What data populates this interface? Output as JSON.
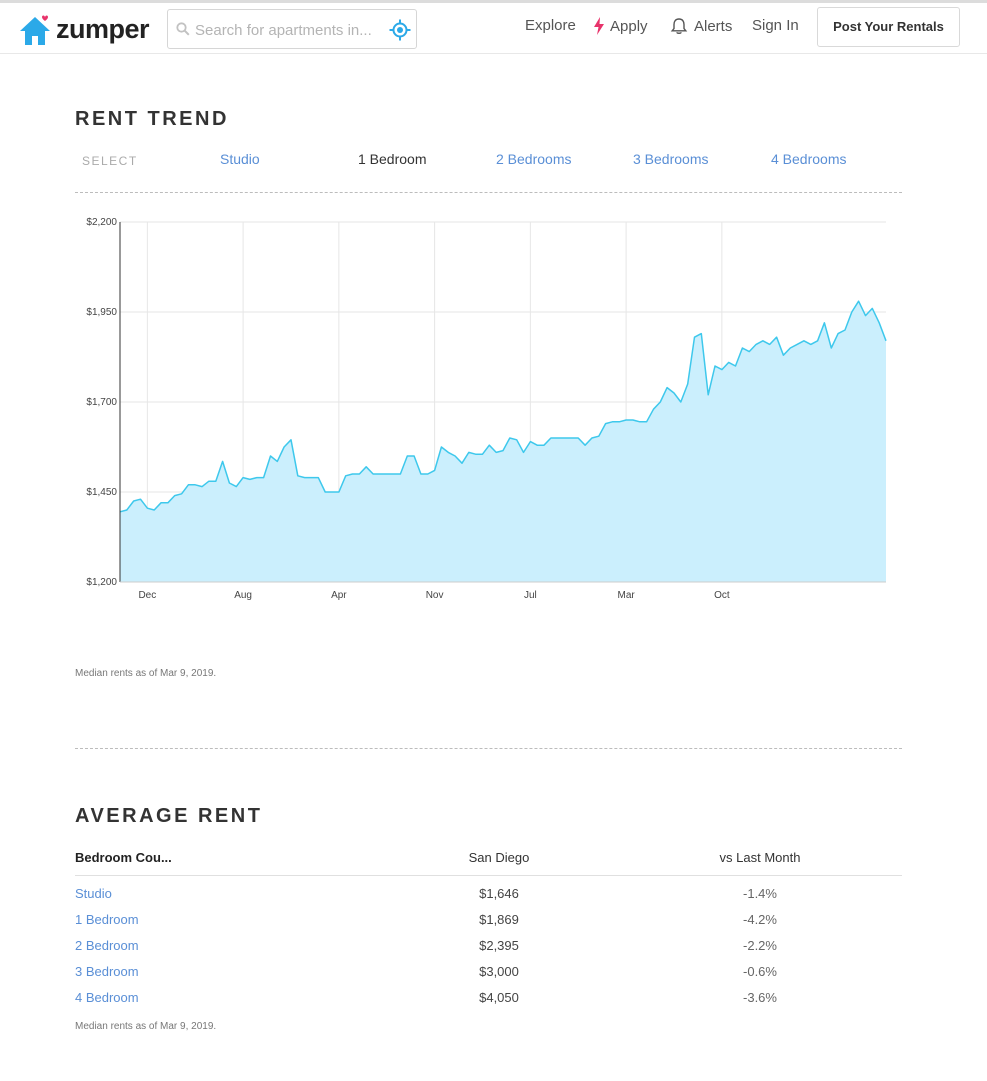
{
  "header": {
    "brand": "zumper",
    "search_placeholder": "Search for apartments in...",
    "nav": {
      "explore": "Explore",
      "apply": "Apply",
      "alerts": "Alerts",
      "sign_in": "Sign In"
    },
    "post_button": "Post Your Rentals",
    "colors": {
      "brand_blue": "#2ba9e8",
      "heart": "#e8336b",
      "apply_bolt": "#e8336b"
    }
  },
  "rent_trend": {
    "title": "RENT TREND",
    "select_label": "SELECT",
    "tabs": [
      {
        "label": "Studio",
        "active": false
      },
      {
        "label": "1 Bedroom",
        "active": true
      },
      {
        "label": "2 Bedrooms",
        "active": false
      },
      {
        "label": "3 Bedrooms",
        "active": false
      },
      {
        "label": "4 Bedrooms",
        "active": false
      }
    ],
    "note": "Median rents as of Mar 9, 2019."
  },
  "chart_data": {
    "type": "area",
    "title": "",
    "xlabel": "",
    "ylabel": "",
    "ylim": [
      1200,
      2200
    ],
    "yticks": [
      1200,
      1450,
      1700,
      1950,
      2200
    ],
    "ytick_labels": [
      "$1,200",
      "$1,450",
      "$1,700",
      "$1,950",
      "$2,200"
    ],
    "x_ticks": [
      {
        "label": "Dec",
        "index": 4
      },
      {
        "label": "Aug",
        "index": 18
      },
      {
        "label": "Apr",
        "index": 32
      },
      {
        "label": "Nov",
        "index": 46
      },
      {
        "label": "Jul",
        "index": 60
      },
      {
        "label": "Mar",
        "index": 74
      },
      {
        "label": "Oct",
        "index": 88
      }
    ],
    "grid": true,
    "colors": {
      "line": "#3ec8ec",
      "fill": "#cbeffd",
      "grid": "#e6e6e6"
    },
    "series": [
      {
        "values": [
          1395,
          1400,
          1425,
          1430,
          1405,
          1400,
          1420,
          1420,
          1440,
          1445,
          1470,
          1470,
          1465,
          1480,
          1480,
          1535,
          1475,
          1465,
          1490,
          1485,
          1490,
          1490,
          1550,
          1535,
          1575,
          1595,
          1495,
          1490,
          1490,
          1490,
          1450,
          1450,
          1450,
          1495,
          1500,
          1500,
          1520,
          1500,
          1500,
          1500,
          1500,
          1500,
          1550,
          1550,
          1500,
          1500,
          1510,
          1575,
          1560,
          1550,
          1530,
          1560,
          1555,
          1555,
          1580,
          1560,
          1565,
          1600,
          1595,
          1560,
          1590,
          1580,
          1580,
          1600,
          1600,
          1600,
          1600,
          1600,
          1580,
          1600,
          1605,
          1640,
          1645,
          1645,
          1650,
          1650,
          1645,
          1645,
          1680,
          1700,
          1740,
          1725,
          1700,
          1750,
          1880,
          1890,
          1720,
          1800,
          1790,
          1810,
          1800,
          1850,
          1840,
          1860,
          1870,
          1860,
          1880,
          1830,
          1850,
          1860,
          1870,
          1860,
          1870,
          1920,
          1850,
          1890,
          1900,
          1950,
          1980,
          1940,
          1960,
          1920,
          1870
        ]
      }
    ]
  },
  "average_rent": {
    "title": "AVERAGE RENT",
    "columns": [
      "Bedroom Cou...",
      "San Diego",
      "vs Last Month"
    ],
    "rows": [
      {
        "bedroom": "Studio",
        "rent": "$1,646",
        "change": "-1.4%"
      },
      {
        "bedroom": "1 Bedroom",
        "rent": "$1,869",
        "change": "-4.2%"
      },
      {
        "bedroom": "2 Bedroom",
        "rent": "$2,395",
        "change": "-2.2%"
      },
      {
        "bedroom": "3 Bedroom",
        "rent": "$3,000",
        "change": "-0.6%"
      },
      {
        "bedroom": "4 Bedroom",
        "rent": "$4,050",
        "change": "-3.6%"
      }
    ],
    "note": "Median rents as of Mar 9, 2019."
  }
}
